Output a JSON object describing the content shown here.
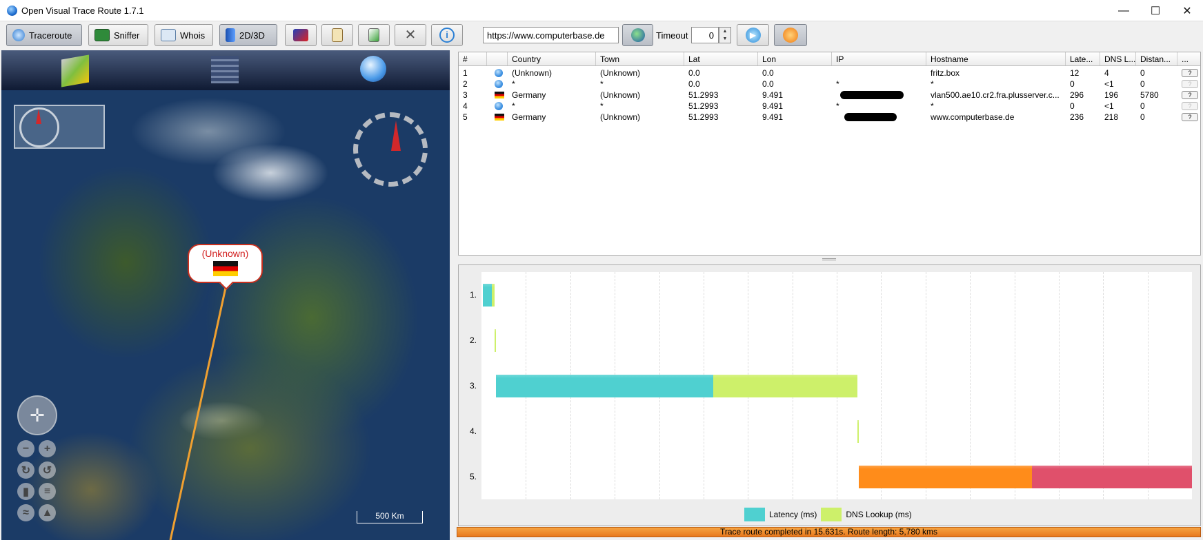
{
  "window": {
    "title": "Open Visual Trace Route 1.7.1"
  },
  "toolbar": {
    "traceroute": "Traceroute",
    "sniffer": "Sniffer",
    "whois": "Whois",
    "view": "2D/3D",
    "url_value": "https://www.computerbase.de",
    "timeout_label": "Timeout",
    "timeout_value": "0"
  },
  "map": {
    "bubble_label": "(Unknown)",
    "scale_label": "500 Km"
  },
  "table": {
    "headers": [
      "#",
      "",
      "Country",
      "Town",
      "Lat",
      "Lon",
      "IP",
      "Hostname",
      "Late...",
      "DNS L...",
      "Distan...",
      "..."
    ],
    "rows": [
      {
        "num": "1",
        "flag": "unknown",
        "country": "(Unknown)",
        "town": "(Unknown)",
        "lat": "0.0",
        "lon": "0.0",
        "ip": "",
        "hostname": "fritz.box",
        "latency": "12",
        "dns": "4",
        "distance": "0",
        "btn": "?"
      },
      {
        "num": "2",
        "flag": "unknown",
        "country": "*",
        "town": "*",
        "lat": "0.0",
        "lon": "0.0",
        "ip": "*",
        "hostname": "*",
        "latency": "0",
        "dns": "<1",
        "distance": "0",
        "btn": "?"
      },
      {
        "num": "3",
        "flag": "de",
        "country": "Germany",
        "town": "(Unknown)",
        "lat": "51.2993",
        "lon": "9.491",
        "ip": "",
        "hostname": "vlan500.ae10.cr2.fra.plusserver.c...",
        "latency": "296",
        "dns": "196",
        "distance": "5780",
        "btn": "?"
      },
      {
        "num": "4",
        "flag": "unknown",
        "country": "*",
        "town": "*",
        "lat": "51.2993",
        "lon": "9.491",
        "ip": "*",
        "hostname": "*",
        "latency": "0",
        "dns": "<1",
        "distance": "0",
        "btn": "?"
      },
      {
        "num": "5",
        "flag": "de",
        "country": "Germany",
        "town": "(Unknown)",
        "lat": "51.2993",
        "lon": "9.491",
        "ip": "",
        "hostname": "www.computerbase.de",
        "latency": "236",
        "dns": "218",
        "distance": "0",
        "btn": "?"
      }
    ]
  },
  "chart_data": {
    "type": "bar",
    "orientation": "horizontal-stacked-gantt",
    "categories": [
      "1.",
      "2.",
      "3.",
      "4.",
      "5."
    ],
    "series": [
      {
        "name": "Latency (ms)",
        "values": [
          12,
          0,
          296,
          0,
          236
        ],
        "color": "#4fd0d0"
      },
      {
        "name": "DNS Lookup (ms)",
        "values": [
          4,
          1,
          196,
          1,
          218
        ],
        "color": "#cdf06a"
      }
    ],
    "hop5_colors": {
      "latency": "#ff8c1a",
      "dns": "#e0506b"
    },
    "legend": "bottom",
    "grid": true
  },
  "status": {
    "text": "Trace route completed in 15.631s. Route length: 5,780 kms"
  }
}
